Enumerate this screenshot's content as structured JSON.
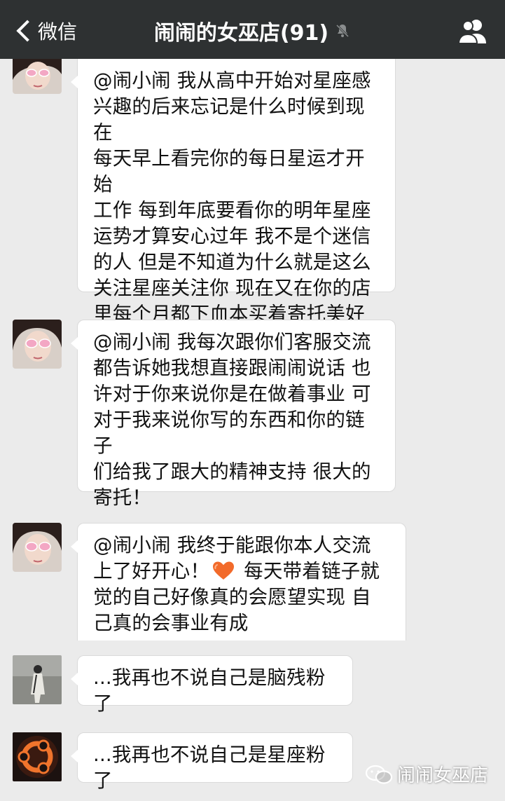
{
  "header": {
    "back_label": "微信",
    "title": "闹闹的女巫店(91)"
  },
  "messages": [
    {
      "id": 1,
      "text": "@闹小闹 我从高中开始对星座感\n兴趣的后来忘记是什么时候到现在\n每天早上看完你的每日星运才开始\n工作 每到年底要看你的明年星座\n运势才算安心过年 我不是个迷信\n的人 但是不知道为什么就是这么\n关注星座关注你 现在又在你的店\n里每个月都下血本买着寄托美好的\n链子们"
    },
    {
      "id": 2,
      "text": "@闹小闹 我每次跟你们客服交流\n都告诉她我想直接跟闹闹说话 也\n许对于你来说你是在做着事业 可\n对于我来说你写的东西和你的链子\n们给我了跟大的精神支持 很大的\n寄托！"
    },
    {
      "id": 3,
      "text_a": "@闹小闹 我终于能跟你本人交流\n上了好开心！",
      "text_b": " 每天带着链子就\n觉的自己好像真的会愿望实现 自\n己真的会事业有成"
    },
    {
      "id": 4,
      "text": "...我再也不说自己是脑残粉了"
    },
    {
      "id": 5,
      "text": "...我再也不说自己是星座粉了"
    }
  ],
  "watermark": {
    "text": "闹闹女巫店"
  },
  "colors": {
    "topbar": "#2e3132",
    "background": "#ebebeb",
    "bubble": "#ffffff",
    "heart": "#f26a2a"
  }
}
